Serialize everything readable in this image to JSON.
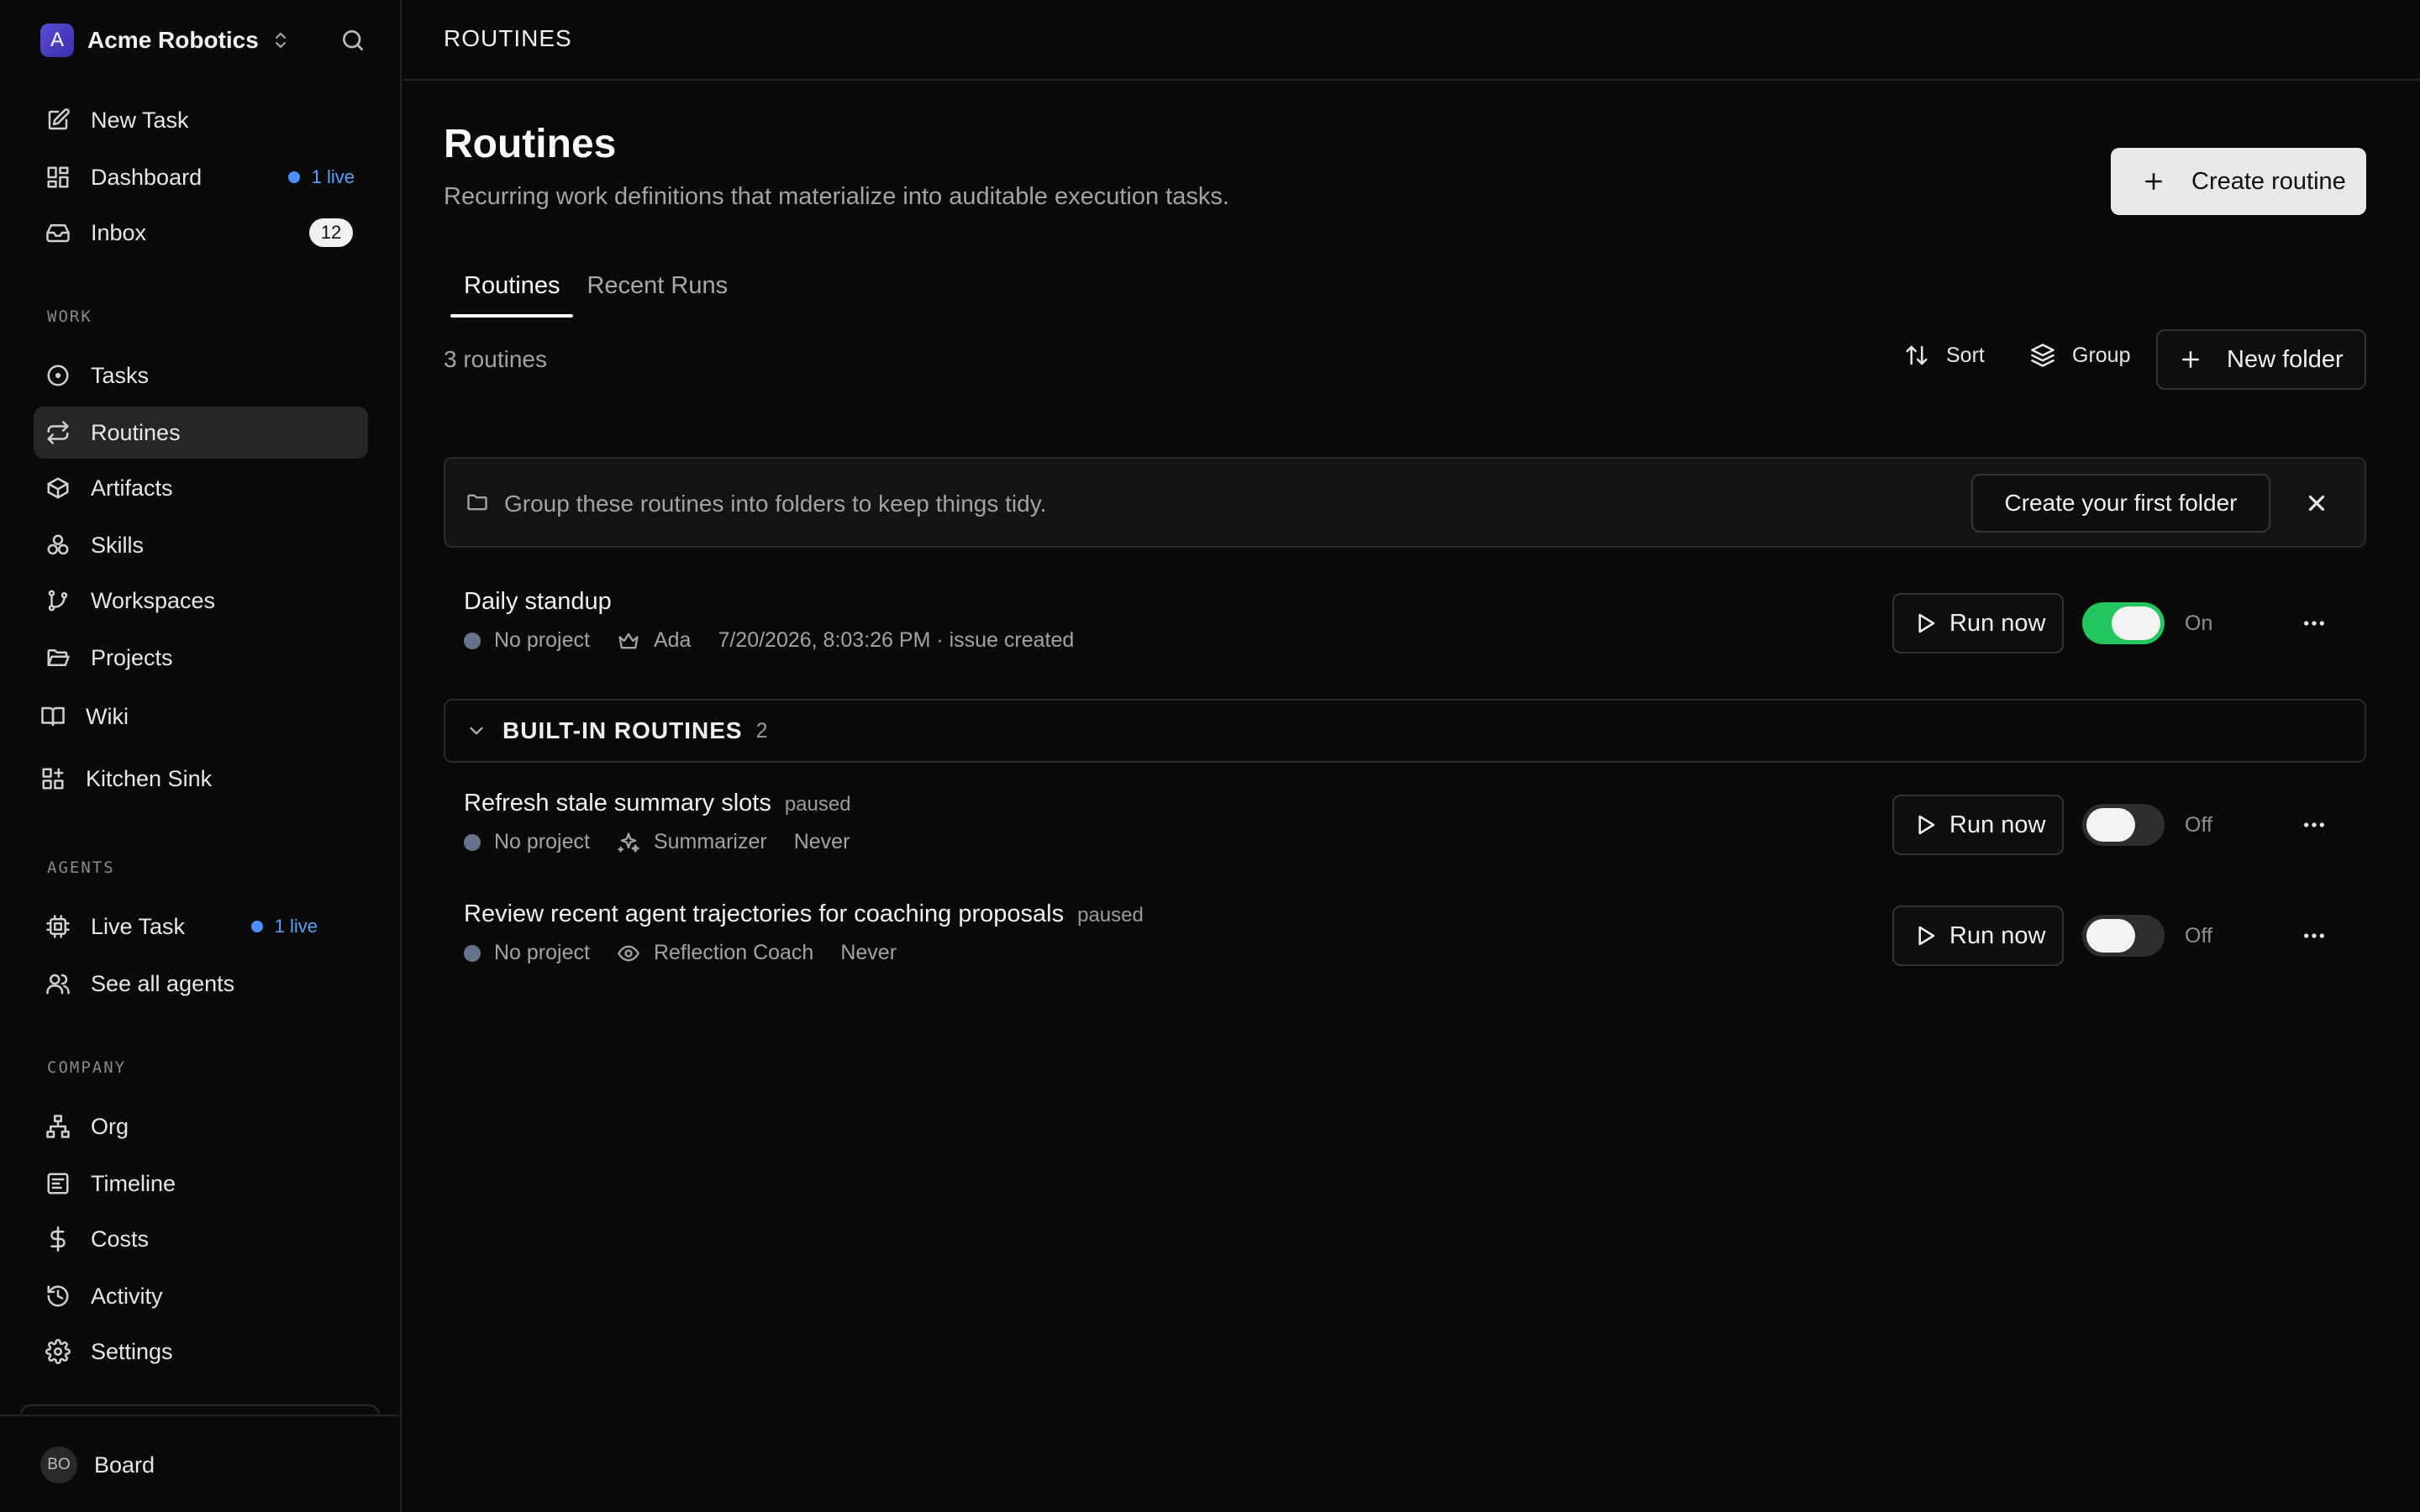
{
  "app": {
    "org_name": "Acme Robotics",
    "org_initial": "A"
  },
  "sidebar": {
    "primary": [
      {
        "label": "New Task",
        "icon": "edit-icon"
      },
      {
        "label": "Dashboard",
        "icon": "dashboard-icon",
        "live": "1 live"
      },
      {
        "label": "Inbox",
        "icon": "inbox-icon",
        "badge": "12"
      }
    ],
    "sections": {
      "work": "WORK",
      "agents": "AGENTS",
      "company": "COMPANY"
    },
    "work_items": [
      {
        "label": "Tasks",
        "icon": "circle-dot-icon"
      },
      {
        "label": "Routines",
        "icon": "repeat-icon",
        "active": true
      },
      {
        "label": "Artifacts",
        "icon": "package-icon"
      },
      {
        "label": "Skills",
        "icon": "boxes-icon"
      },
      {
        "label": "Workspaces",
        "icon": "git-branch-icon"
      },
      {
        "label": "Projects",
        "icon": "folder-open-icon"
      }
    ],
    "extra_items": [
      {
        "label": "Wiki",
        "icon": "book-icon"
      },
      {
        "label": "Kitchen Sink",
        "icon": "grid-plus-icon"
      }
    ],
    "agent_items": [
      {
        "label": "Live Task",
        "icon": "cpu-icon",
        "live": "1 live"
      },
      {
        "label": "See all agents",
        "icon": "users-icon"
      }
    ],
    "company_items": [
      {
        "label": "Org",
        "icon": "org-chart-icon"
      },
      {
        "label": "Timeline",
        "icon": "timeline-icon"
      },
      {
        "label": "Costs",
        "icon": "dollar-icon"
      },
      {
        "label": "Activity",
        "icon": "history-icon"
      },
      {
        "label": "Settings",
        "icon": "gear-icon"
      }
    ],
    "user": {
      "initials": "BO",
      "name": "Board"
    }
  },
  "header": {
    "breadcrumb": "ROUTINES"
  },
  "page": {
    "title": "Routines",
    "subtitle": "Recurring work definitions that materialize into auditable execution tasks.",
    "create_label": "Create routine",
    "tabs": [
      "Routines",
      "Recent Runs"
    ],
    "count": "3 routines",
    "sort_label": "Sort",
    "group_label": "Group",
    "new_folder_label": "New folder"
  },
  "banner": {
    "message": "Group these routines into folders to keep things tidy.",
    "cta": "Create your first folder"
  },
  "routines": [
    {
      "name": "Daily standup",
      "status": "",
      "project": "No project",
      "agent": "Ada",
      "agent_icon": "crown-icon",
      "last_run": "7/20/2026, 8:03:26 PM · issue created",
      "run_label": "Run now",
      "enabled": true,
      "toggle_label": "On"
    }
  ],
  "builtin_group": {
    "title": "BUILT-IN ROUTINES",
    "count": "2",
    "routines": [
      {
        "name": "Refresh stale summary slots",
        "status": "paused",
        "project": "No project",
        "agent": "Summarizer",
        "agent_icon": "sparkles-icon",
        "last_run": "Never",
        "run_label": "Run now",
        "enabled": false,
        "toggle_label": "Off"
      },
      {
        "name": "Review recent agent trajectories for coaching proposals",
        "status": "paused",
        "project": "No project",
        "agent": "Reflection Coach",
        "agent_icon": "eye-icon",
        "last_run": "Never",
        "run_label": "Run now",
        "enabled": false,
        "toggle_label": "Off"
      }
    ]
  },
  "colors": {
    "background": "#0a0a0a",
    "toggle_on": "#22c55e",
    "live_dot": "#4a90ff"
  }
}
